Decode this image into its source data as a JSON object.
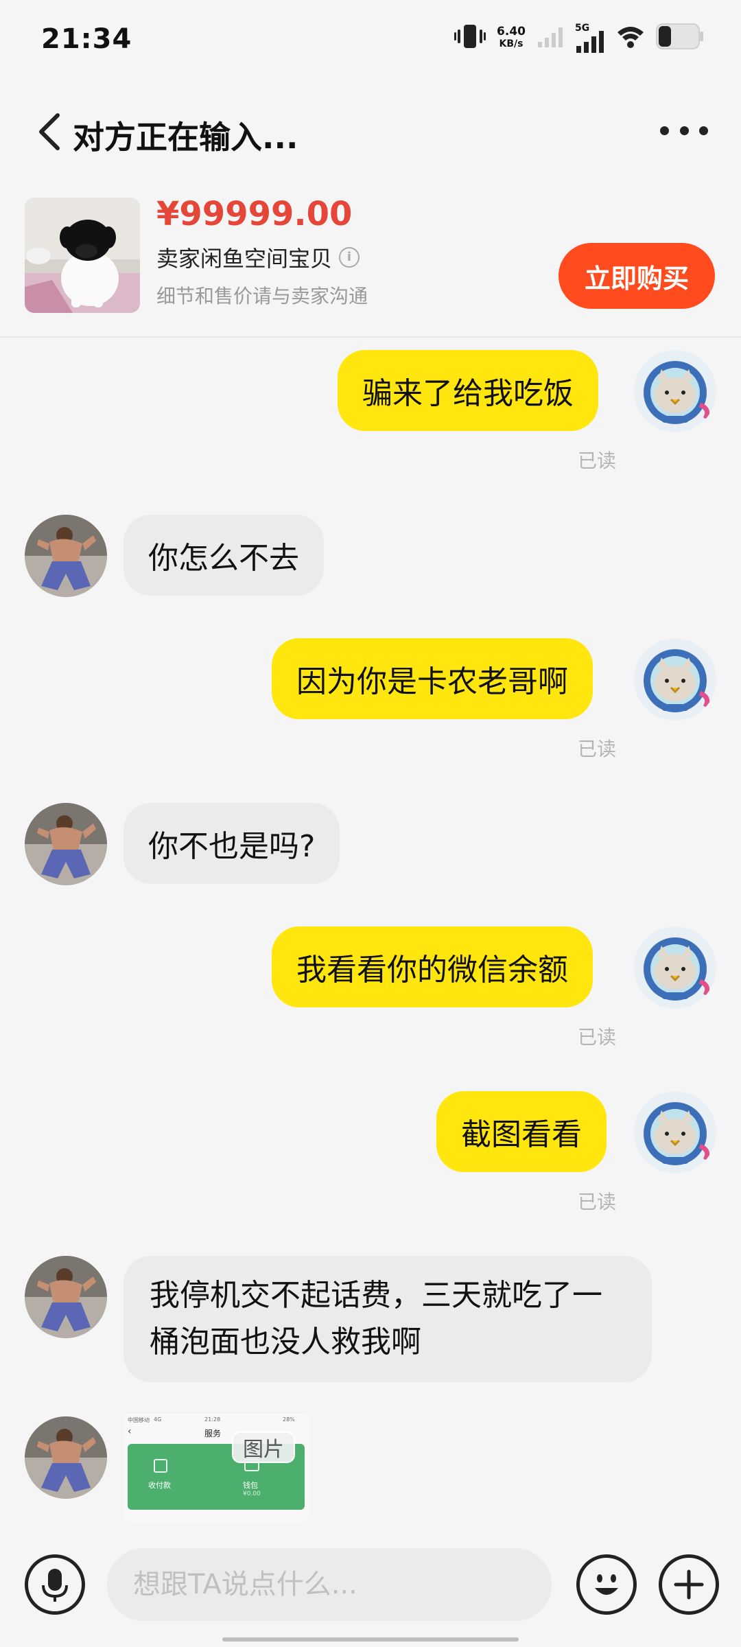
{
  "status_bar": {
    "time": "21:34",
    "speed_value": "6.40",
    "speed_unit": "KB/s",
    "network": "5G",
    "icons": [
      "vibrate-icon",
      "signal-weak-icon",
      "signal-5g-icon",
      "wifi-icon",
      "battery-icon"
    ]
  },
  "header": {
    "title": "对方正在输入...",
    "back_icon": "chevron-left-icon",
    "more_icon": "more-icon"
  },
  "product": {
    "price": "¥99999.00",
    "title": "卖家闲鱼空间宝贝",
    "info_icon": "i",
    "note": "细节和售价请与卖家沟通",
    "buy_label": "立即购买"
  },
  "messages": [
    {
      "from": "me",
      "text": "骗来了给我吃饭",
      "status": "已读"
    },
    {
      "from": "them",
      "text": "你怎么不去"
    },
    {
      "from": "me",
      "text": "因为你是卡农老哥啊",
      "status": "已读"
    },
    {
      "from": "them",
      "text": "你不也是吗?"
    },
    {
      "from": "me",
      "text": "我看看你的微信余额",
      "status": "已读"
    },
    {
      "from": "me",
      "text": "截图看看",
      "status": "已读"
    },
    {
      "from": "them",
      "text": "我停机交不起话费，三天就吃了一桶泡面也没人救我啊"
    },
    {
      "from": "them",
      "type": "image",
      "tag": "图片",
      "shot": {
        "carrier": "中国移动",
        "net": "4G",
        "time": "21:28",
        "battery": "28%",
        "title": "服务",
        "left_item": "收付款",
        "right_item": "钱包",
        "right_value": "¥0.00"
      }
    }
  ],
  "input": {
    "placeholder": "想跟TA说点什么...",
    "value": ""
  },
  "colors": {
    "my_bubble": "#ffe60f",
    "their_bubble": "#ebebeb",
    "price": "#e4473a",
    "buy_button": "#ff4b1e"
  }
}
